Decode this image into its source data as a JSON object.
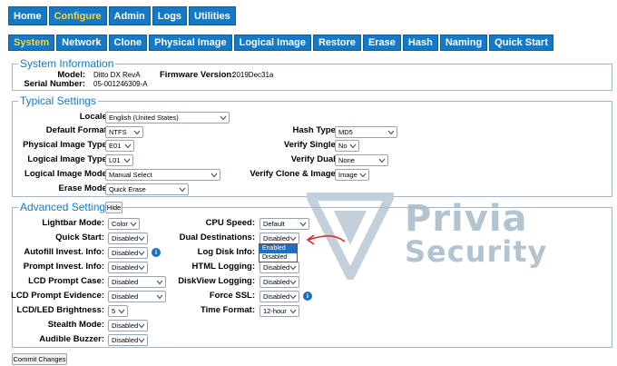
{
  "top_nav": [
    "Home",
    "Configure",
    "Admin",
    "Logs",
    "Utilities"
  ],
  "sub_nav": [
    "System",
    "Network",
    "Clone",
    "Physical Image",
    "Logical Image",
    "Restore",
    "Erase",
    "Hash",
    "Naming",
    "Quick Start"
  ],
  "system_info": {
    "legend": "System Information",
    "model_label": "Model:",
    "model_value": "Ditto DX RevA",
    "serial_label": "Serial Number:",
    "serial_value": "05-001246309-A",
    "firmware_label": "Firmware Version:",
    "firmware_value": "2019Dec31a"
  },
  "typical": {
    "legend": "Typical Settings",
    "locale_label": "Locale:",
    "locale_value": "English (United States)",
    "default_format_label": "Default Format:",
    "default_format_value": "NTFS",
    "physical_image_type_label": "Physical Image Type:",
    "physical_image_type_value": "E01",
    "logical_image_type_label": "Logical Image Type:",
    "logical_image_type_value": "L01",
    "logical_image_mode_label": "Logical Image Mode:",
    "logical_image_mode_value": "Manual Select",
    "erase_mode_label": "Erase Mode:",
    "erase_mode_value": "Quick Erase",
    "hash_type_label": "Hash Type:",
    "hash_type_value": "MD5",
    "verify_single_label": "Verify Single:",
    "verify_single_value": "No",
    "verify_dual_label": "Verify Dual:",
    "verify_dual_value": "None",
    "verify_clone_label": "Verify Clone & Image:",
    "verify_clone_value": "Image"
  },
  "advanced": {
    "legend": "Advanced Settings",
    "hide_label": "Hide",
    "lightbar_label": "Lightbar Mode:",
    "lightbar_value": "Color",
    "quick_start_label": "Quick Start:",
    "quick_start_value": "Disabled",
    "autofill_label": "Autofill Invest. Info:",
    "autofill_value": "Disabled",
    "prompt_invest_label": "Prompt Invest. Info:",
    "prompt_invest_value": "Disabled",
    "lcd_prompt_case_label": "LCD Prompt Case:",
    "lcd_prompt_case_value": "Disabled",
    "lcd_prompt_evidence_label": "LCD Prompt Evidence:",
    "lcd_prompt_evidence_value": "Disabled",
    "lcd_brightness_label": "LCD/LED Brightness:",
    "lcd_brightness_value": "5",
    "stealth_label": "Stealth Mode:",
    "stealth_value": "Disabled",
    "buzzer_label": "Audible Buzzer:",
    "buzzer_value": "Disabled",
    "cpu_speed_label": "CPU Speed:",
    "cpu_speed_value": "Default",
    "dual_dest_label": "Dual Destinations:",
    "dual_dest_value": "Disabled",
    "dual_dest_options": [
      "Enabled",
      "Disabled"
    ],
    "log_disk_label": "Log Disk Info:",
    "html_logging_label": "HTML Logging:",
    "html_logging_value": "Disabled",
    "diskview_logging_label": "DiskView Logging:",
    "diskview_logging_value": "Disabled",
    "force_ssl_label": "Force SSL:",
    "force_ssl_value": "Disabled",
    "time_format_label": "Time Format:",
    "time_format_value": "12-hour"
  },
  "commit_label": "Commit Changes",
  "watermark": {
    "line1": "Privia",
    "line2": "Security"
  },
  "colors": {
    "tab_bg": "#1479c7",
    "tab_active_text": "#ffd23a",
    "legend_text": "#1479c7",
    "annotation_arrow": "#d62828"
  }
}
